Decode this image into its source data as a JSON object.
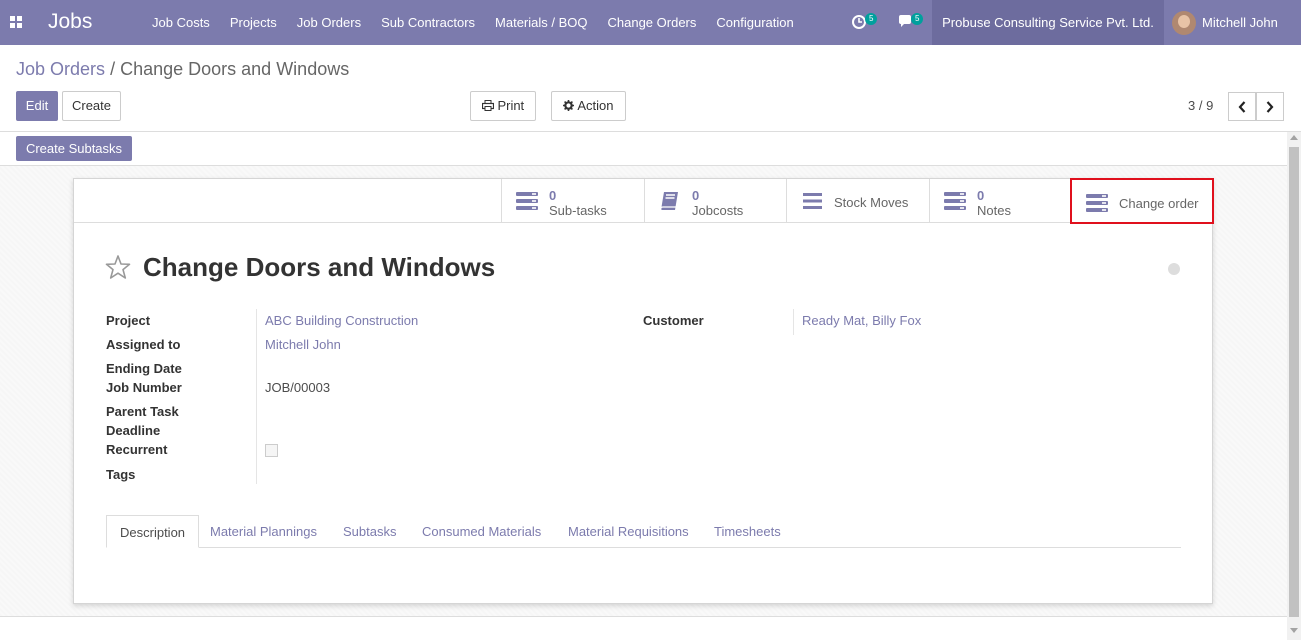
{
  "navbar": {
    "brand": "Jobs",
    "menu": [
      "Job Costs",
      "Projects",
      "Job Orders",
      "Sub Contractors",
      "Materials / BOQ",
      "Change Orders",
      "Configuration"
    ],
    "activity_count": "5",
    "message_count": "5",
    "company": "Probuse Consulting Service Pvt. Ltd.",
    "user": "Mitchell John",
    "colors": {
      "navbar_bg": "#7c7bad",
      "company_bg": "#6d6c9e",
      "badge": "#00a09d"
    }
  },
  "breadcrumb": {
    "parent": "Job Orders",
    "separator": "/",
    "current": "Change Doors and Windows"
  },
  "toolbar": {
    "edit": "Edit",
    "create": "Create",
    "print": "Print",
    "action": "Action",
    "pager": "3 / 9"
  },
  "statusbar": {
    "create_subtasks": "Create Subtasks"
  },
  "smart_buttons": {
    "subtasks": {
      "value": "0",
      "label": "Sub-tasks"
    },
    "jobcosts": {
      "value": "0",
      "label": "Jobcosts"
    },
    "stock_moves": {
      "label": "Stock Moves"
    },
    "notes": {
      "value": "0",
      "label": "Notes"
    },
    "change_order": {
      "label": "Change order"
    }
  },
  "record": {
    "title": "Change Doors and Windows",
    "fields": {
      "project": {
        "label": "Project",
        "value": "ABC Building Construction"
      },
      "assigned_to": {
        "label": "Assigned to",
        "value": "Mitchell John"
      },
      "ending_date": {
        "label": "Ending Date",
        "value": ""
      },
      "job_number": {
        "label": "Job Number",
        "value": "JOB/00003"
      },
      "parent_task": {
        "label": "Parent Task",
        "value": ""
      },
      "deadline": {
        "label": "Deadline",
        "value": ""
      },
      "recurrent": {
        "label": "Recurrent",
        "checked": false
      },
      "tags": {
        "label": "Tags",
        "value": ""
      },
      "customer": {
        "label": "Customer",
        "value": "Ready Mat, Billy Fox"
      }
    }
  },
  "tabs": [
    "Description",
    "Material Plannings",
    "Subtasks",
    "Consumed Materials",
    "Material Requisitions",
    "Timesheets"
  ],
  "active_tab": "Description"
}
